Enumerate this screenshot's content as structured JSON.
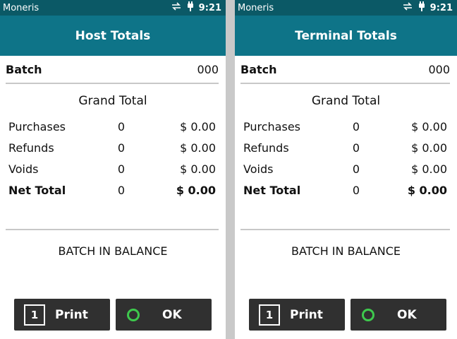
{
  "status": {
    "app_name": "Moneris",
    "time": "9:21"
  },
  "panels": [
    {
      "title": "Host Totals",
      "batch_label": "Batch",
      "batch_value": "000",
      "grand_total_title": "Grand Total",
      "rows": [
        {
          "label": "Purchases",
          "count": "0",
          "amount": "$ 0.00"
        },
        {
          "label": "Refunds",
          "count": "0",
          "amount": "$ 0.00"
        },
        {
          "label": "Voids",
          "count": "0",
          "amount": "$ 0.00"
        },
        {
          "label": "Net Total",
          "count": "0",
          "amount": "$ 0.00"
        }
      ],
      "balance_text": "BATCH IN BALANCE",
      "print_key": "1",
      "print_label": "Print",
      "ok_label": "OK"
    },
    {
      "title": "Terminal Totals",
      "batch_label": "Batch",
      "batch_value": "000",
      "grand_total_title": "Grand Total",
      "rows": [
        {
          "label": "Purchases",
          "count": "0",
          "amount": "$ 0.00"
        },
        {
          "label": "Refunds",
          "count": "0",
          "amount": "$ 0.00"
        },
        {
          "label": "Voids",
          "count": "0",
          "amount": "$ 0.00"
        },
        {
          "label": "Net Total",
          "count": "0",
          "amount": "$ 0.00"
        }
      ],
      "balance_text": "BATCH IN BALANCE",
      "print_key": "1",
      "print_label": "Print",
      "ok_label": "OK"
    }
  ],
  "colors": {
    "status_bar": "#0b5966",
    "title_bar": "#0e7488",
    "button": "#303030",
    "ok_ring": "#3ec94d"
  },
  "icons": {
    "status": [
      "sync-arrows-icon",
      "power-plug-icon"
    ],
    "ok": "green-ring-icon"
  }
}
